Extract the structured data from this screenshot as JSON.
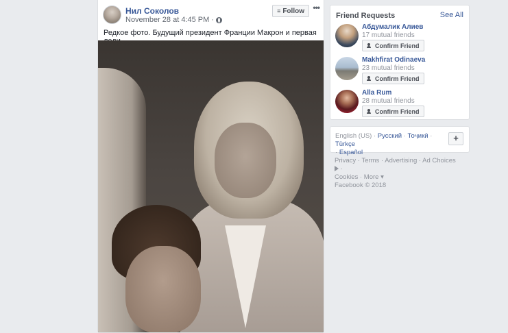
{
  "post": {
    "author": "Нил Соколов",
    "timestamp": "November 28 at 4:45 PM",
    "separator": "·",
    "follow_label": "Follow",
    "more_label": "•••",
    "text": "Редкое фото. Будущий президент Франции Макрон и первая леди"
  },
  "friend_requests": {
    "title": "Friend Requests",
    "see_all": "See All",
    "items": [
      {
        "name": "Абдумалик Алиев",
        "mutual": "17 mutual friends",
        "button": "Confirm Friend"
      },
      {
        "name": "Makhfirat Odinaeva",
        "mutual": "23 mutual friends",
        "button": "Confirm Friend"
      },
      {
        "name": "Alla Rum",
        "mutual": "28 mutual friends",
        "button": "Confirm Friend"
      }
    ]
  },
  "languages": {
    "current": "English (US)",
    "sep": " · ",
    "items": [
      "Русский",
      "Тоҷикӣ",
      "Türkçe",
      "Español"
    ],
    "add_label": "+"
  },
  "footer": {
    "sep": " · ",
    "links": [
      "Privacy",
      "Terms",
      "Advertising",
      "Ad Choices",
      "Cookies",
      "More"
    ],
    "copyright": "Facebook © 2018"
  }
}
